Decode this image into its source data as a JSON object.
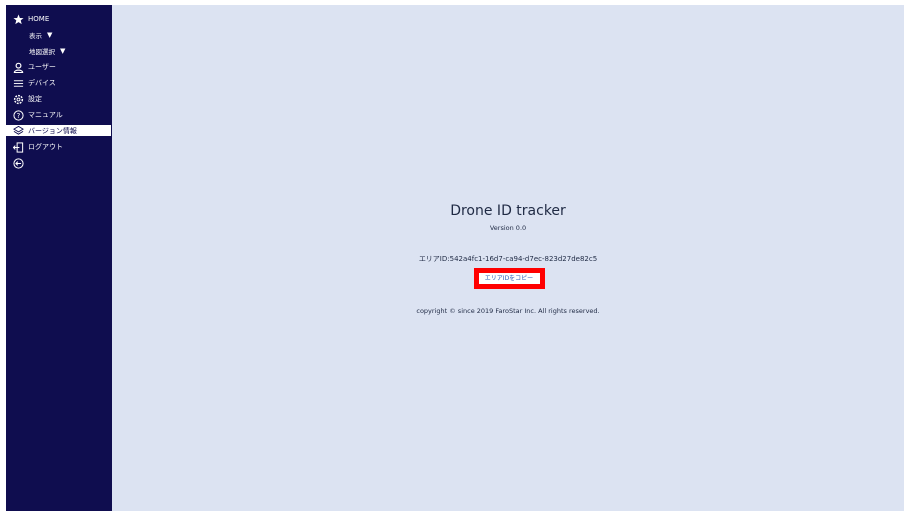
{
  "sidebar": {
    "items": [
      {
        "label": "HOME",
        "icon": "star-icon"
      },
      {
        "label": "表示",
        "caret": "▼"
      },
      {
        "label": "地図選択",
        "caret": "▼"
      },
      {
        "label": "ユーザー",
        "icon": "user-icon"
      },
      {
        "label": "デバイス",
        "icon": "list-icon"
      },
      {
        "label": "設定",
        "icon": "gear-icon"
      },
      {
        "label": "マニュアル",
        "icon": "help-icon"
      },
      {
        "label": "バージョン情報",
        "icon": "layers-icon",
        "active": true
      },
      {
        "label": "ログアウト",
        "icon": "logout-icon"
      },
      {
        "label": "",
        "icon": "collapse-icon"
      }
    ]
  },
  "about": {
    "title": "Drone ID tracker",
    "version": "Version 0.0",
    "area_id": "エリアID:542a4fc1-16d7-ca94-d7ec-823d27de82c5",
    "copy_button": "エリアIDをコピー",
    "copyright": "copyright © since 2019 FaroStar Inc. All rights reserved."
  },
  "colors": {
    "sidebar_bg": "#0f0d4f",
    "main_bg": "#dce3f2",
    "highlight": "#ff0000"
  }
}
